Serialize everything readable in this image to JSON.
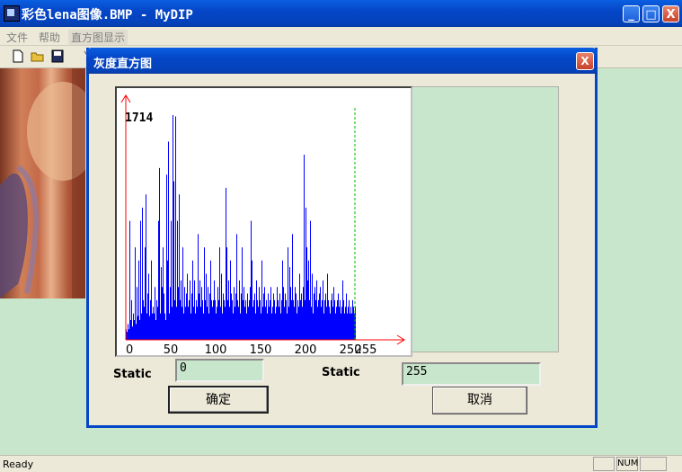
{
  "window": {
    "title": "彩色lena图像.BMP - MyDIP",
    "minimize_glyph": "_",
    "maximize_glyph": "□",
    "close_glyph": "X"
  },
  "menu": [
    {
      "label": "文件"
    },
    {
      "label": "帮助"
    },
    {
      "label": "直方图显示"
    }
  ],
  "toolbar": {
    "icons": [
      "new-file-icon",
      "open-folder-icon",
      "save-icon",
      "cut-icon"
    ]
  },
  "status": {
    "text": "Ready",
    "num_indicator": "NUM"
  },
  "dialog": {
    "title": "灰度直方图",
    "close_glyph": "X",
    "histogram": {
      "max_label": "1714",
      "x_ticks": [
        "0",
        "50",
        "100",
        "150",
        "200",
        "250"
      ],
      "extra_tick": "255"
    },
    "static_left_label": "Static",
    "static_left_value": "0",
    "static_right_label": "Static",
    "static_right_value": "255",
    "ok_label": "确定",
    "cancel_label": "取消"
  },
  "chart_data": {
    "type": "bar",
    "title": "",
    "xlabel": "",
    "ylabel": "",
    "xlim": [
      0,
      255
    ],
    "ylim": [
      0,
      1714
    ],
    "bar_color": "#0000ff",
    "axis_color": "#ff0000",
    "marker_color": "#00c000",
    "markers": [
      0,
      255
    ],
    "x": [
      0,
      1,
      2,
      3,
      4,
      5,
      6,
      7,
      8,
      9,
      10,
      11,
      12,
      13,
      14,
      15,
      16,
      17,
      18,
      19,
      20,
      21,
      22,
      23,
      24,
      25,
      26,
      27,
      28,
      29,
      30,
      31,
      32,
      33,
      34,
      35,
      36,
      37,
      38,
      39,
      40,
      41,
      42,
      43,
      44,
      45,
      46,
      47,
      48,
      49,
      50,
      51,
      52,
      53,
      54,
      55,
      56,
      57,
      58,
      59,
      60,
      61,
      62,
      63,
      64,
      65,
      66,
      67,
      68,
      69,
      70,
      71,
      72,
      73,
      74,
      75,
      76,
      77,
      78,
      79,
      80,
      81,
      82,
      83,
      84,
      85,
      86,
      87,
      88,
      89,
      90,
      91,
      92,
      93,
      94,
      95,
      96,
      97,
      98,
      99,
      100,
      101,
      102,
      103,
      104,
      105,
      106,
      107,
      108,
      109,
      110,
      111,
      112,
      113,
      114,
      115,
      116,
      117,
      118,
      119,
      120,
      121,
      122,
      123,
      124,
      125,
      126,
      127,
      128,
      129,
      130,
      131,
      132,
      133,
      134,
      135,
      136,
      137,
      138,
      139,
      140,
      141,
      142,
      143,
      144,
      145,
      146,
      147,
      148,
      149,
      150,
      151,
      152,
      153,
      154,
      155,
      156,
      157,
      158,
      159,
      160,
      161,
      162,
      163,
      164,
      165,
      166,
      167,
      168,
      169,
      170,
      171,
      172,
      173,
      174,
      175,
      176,
      177,
      178,
      179,
      180,
      181,
      182,
      183,
      184,
      185,
      186,
      187,
      188,
      189,
      190,
      191,
      192,
      193,
      194,
      195,
      196,
      197,
      198,
      199,
      200,
      201,
      202,
      203,
      204,
      205,
      206,
      207,
      208,
      209,
      210,
      211,
      212,
      213,
      214,
      215,
      216,
      217,
      218,
      219,
      220,
      221,
      222,
      223,
      224,
      225,
      226,
      227,
      228,
      229,
      230,
      231,
      232,
      233,
      234,
      235,
      236,
      237,
      238,
      239,
      240,
      241,
      242,
      243,
      244,
      245,
      246,
      247,
      248,
      249,
      250,
      251,
      252,
      253,
      254,
      255
    ],
    "values": [
      80,
      60,
      120,
      80,
      900,
      150,
      300,
      100,
      200,
      150,
      700,
      120,
      400,
      180,
      600,
      150,
      900,
      200,
      1000,
      300,
      250,
      700,
      1100,
      200,
      350,
      500,
      180,
      300,
      600,
      200,
      250,
      200,
      400,
      150,
      300,
      250,
      900,
      1300,
      200,
      550,
      400,
      700,
      350,
      200,
      150,
      1250,
      600,
      1500,
      200,
      400,
      900,
      250,
      1700,
      1200,
      300,
      1690,
      250,
      900,
      400,
      1100,
      300,
      450,
      250,
      700,
      200,
      400,
      250,
      350,
      500,
      250,
      300,
      450,
      200,
      350,
      600,
      250,
      450,
      200,
      300,
      250,
      800,
      350,
      450,
      250,
      400,
      300,
      200,
      700,
      300,
      500,
      250,
      400,
      200,
      350,
      600,
      300,
      250,
      300,
      450,
      300,
      200,
      250,
      400,
      300,
      700,
      250,
      500,
      200,
      350,
      300,
      250,
      1150,
      700,
      300,
      450,
      250,
      600,
      350,
      300,
      200,
      400,
      250,
      350,
      800,
      300,
      250,
      450,
      200,
      350,
      700,
      300,
      400,
      250,
      300,
      200,
      350,
      250,
      300,
      400,
      900,
      600,
      250,
      300,
      350,
      200,
      450,
      300,
      250,
      400,
      300,
      200,
      600,
      250,
      350,
      400,
      250,
      300,
      200,
      350,
      250,
      300,
      400,
      200,
      250,
      350,
      300,
      200,
      250,
      400,
      300,
      250,
      350,
      200,
      300,
      600,
      400,
      250,
      350,
      300,
      200,
      700,
      250,
      550,
      400,
      300,
      800,
      300,
      250,
      400,
      350,
      200,
      300,
      250,
      500,
      300,
      350,
      250,
      400,
      1400,
      300,
      1000,
      700,
      450,
      600,
      300,
      900,
      250,
      500,
      200,
      350,
      400,
      300,
      450,
      250,
      300,
      350,
      400,
      250,
      300,
      450,
      200,
      300,
      350,
      250,
      500,
      300,
      250,
      200,
      300,
      350,
      250,
      400,
      300,
      200,
      250,
      300,
      350,
      250,
      300,
      200,
      250,
      450,
      300,
      200,
      250,
      350,
      200,
      250,
      300,
      200,
      250,
      200,
      300,
      250,
      200,
      250,
      300,
      200,
      250,
      200,
      350
    ]
  }
}
